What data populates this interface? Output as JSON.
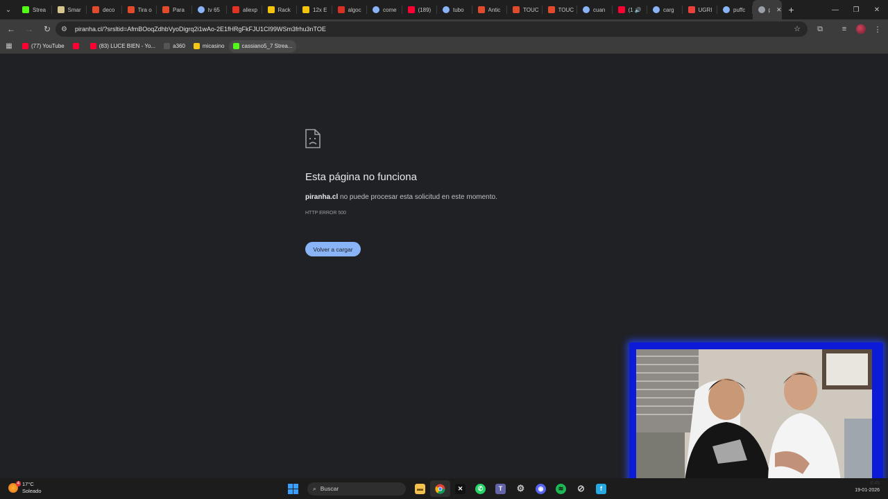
{
  "browser": {
    "tabs": [
      {
        "label": "Strea",
        "icon": "kick-icon",
        "color": "#53fc18"
      },
      {
        "label": "Smar",
        "icon": "smart-icon",
        "color": "#d6c58a"
      },
      {
        "label": "deco",
        "icon": "brave-shield-icon",
        "color": "#e24a2c"
      },
      {
        "label": "Tira o",
        "icon": "brave-shield-icon",
        "color": "#e24a2c"
      },
      {
        "label": "Para",
        "icon": "brave-shield-icon",
        "color": "#e24a2c"
      },
      {
        "label": "tv 65",
        "icon": "google-icon",
        "color": "#8ab4f8"
      },
      {
        "label": "aliexp",
        "icon": "aliexpress-icon",
        "color": "#e43225"
      },
      {
        "label": "Rack",
        "icon": "ml-icon",
        "color": "#f2c40f"
      },
      {
        "label": "12x E",
        "icon": "ml-icon",
        "color": "#f2c40f"
      },
      {
        "label": "algoc",
        "icon": "generic-red-icon",
        "color": "#d93025"
      },
      {
        "label": "come",
        "icon": "google-icon",
        "color": "#8ab4f8"
      },
      {
        "label": "(189)",
        "icon": "youtube-icon",
        "color": "#ff0033"
      },
      {
        "label": "tubo",
        "icon": "google-icon",
        "color": "#8ab4f8"
      },
      {
        "label": "Antic",
        "icon": "brave-shield-icon",
        "color": "#e24a2c"
      },
      {
        "label": "TOUC",
        "icon": "brave-shield-icon",
        "color": "#e24a2c"
      },
      {
        "label": "TOUC",
        "icon": "brave-shield-icon",
        "color": "#e24a2c"
      },
      {
        "label": "cuan",
        "icon": "google-icon",
        "color": "#8ab4f8"
      },
      {
        "label": "(1 🔊",
        "icon": "youtube-icon",
        "color": "#ff0033"
      },
      {
        "label": "carg",
        "icon": "google-icon",
        "color": "#8ab4f8"
      },
      {
        "label": "UGRI",
        "icon": "ugreen-icon",
        "color": "#e9413c"
      },
      {
        "label": "puffc",
        "icon": "google-icon",
        "color": "#8ab4f8"
      },
      {
        "label": "p",
        "icon": "globe-icon",
        "color": "#9aa0a6",
        "active": true
      }
    ],
    "url": "piranha.cl/?srsltid=AfmBOoqZdhbVyoDigrq2i1wAo-2E1fHRgFkFJU1CI99WSm3frhu3nTOE",
    "bookmarks": [
      {
        "label": "(77) YouTube",
        "color": "#ff0033"
      },
      {
        "label": "",
        "color": "#ff0033"
      },
      {
        "label": "(83) LUCE BIEN - Yo...",
        "color": "#ff0033"
      },
      {
        "label": "a360",
        "color": "#555555"
      },
      {
        "label": "micasino",
        "color": "#f5c518"
      },
      {
        "label": "cassiano5_7 Strea...",
        "color": "#53fc18"
      }
    ]
  },
  "error_page": {
    "title": "Esta página no funciona",
    "host": "piranha.cl",
    "message": " no puede procesar esta solicitud en este momento.",
    "code": "HTTP ERROR 500",
    "reload_label": "Volver a cargar"
  },
  "taskbar": {
    "temperature": "17°C",
    "condition": "Soleado",
    "weather_badge": "4",
    "search_placeholder": "Buscar",
    "time": "8:45",
    "date": "19-01-2026"
  }
}
